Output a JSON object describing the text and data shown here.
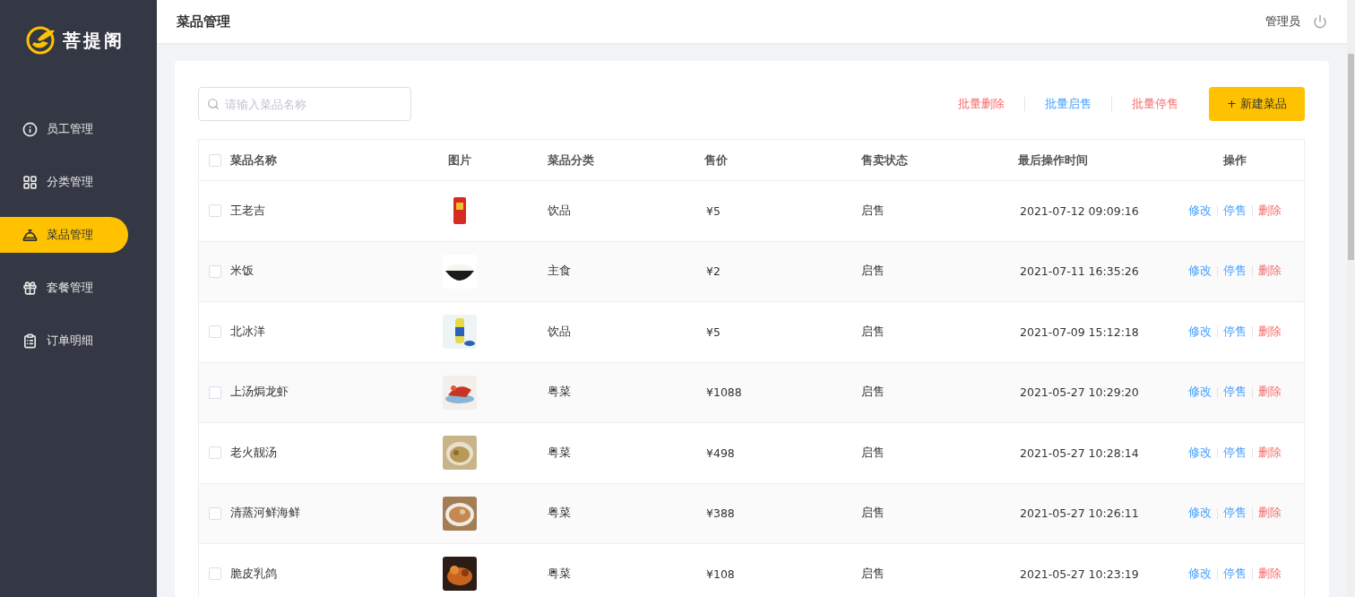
{
  "brand": {
    "name": "菩提阁"
  },
  "sidebar": {
    "items": [
      {
        "label": "员工管理",
        "selected": false
      },
      {
        "label": "分类管理",
        "selected": false
      },
      {
        "label": "菜品管理",
        "selected": true
      },
      {
        "label": "套餐管理",
        "selected": false
      },
      {
        "label": "订单明细",
        "selected": false
      }
    ]
  },
  "header": {
    "title": "菜品管理",
    "user": "管理员"
  },
  "toolbar": {
    "search": {
      "placeholder": "请输入菜品名称"
    },
    "actions": [
      {
        "label": "批量删除",
        "kind": "danger"
      },
      {
        "label": "批量启售",
        "kind": "primary"
      },
      {
        "label": "批量停售",
        "kind": "danger"
      }
    ],
    "create_button": "+ 新建菜品"
  },
  "table": {
    "select_all": {
      "checked": false
    },
    "columns": [
      "菜品名称",
      "图片",
      "菜品分类",
      "售价",
      "售卖状态",
      "最后操作时间",
      "操作"
    ],
    "rows": [
      {
        "checked": false,
        "name": "王老吉",
        "category": "饮品",
        "price": "¥5",
        "status": "启售",
        "updated": "2021-07-12 09:09:16",
        "actions": [
          {
            "label": "修改",
            "kind": "primary"
          },
          {
            "label": "停售",
            "kind": "primary"
          },
          {
            "label": "删除",
            "kind": "danger"
          }
        ]
      },
      {
        "checked": false,
        "name": "米饭",
        "category": "主食",
        "price": "¥2",
        "status": "启售",
        "updated": "2021-07-11 16:35:26",
        "actions": [
          {
            "label": "修改",
            "kind": "primary"
          },
          {
            "label": "停售",
            "kind": "primary"
          },
          {
            "label": "删除",
            "kind": "danger"
          }
        ]
      },
      {
        "checked": false,
        "name": "北冰洋",
        "category": "饮品",
        "price": "¥5",
        "status": "启售",
        "updated": "2021-07-09 15:12:18",
        "actions": [
          {
            "label": "修改",
            "kind": "primary"
          },
          {
            "label": "停售",
            "kind": "primary"
          },
          {
            "label": "删除",
            "kind": "danger"
          }
        ]
      },
      {
        "checked": false,
        "name": "上汤焗龙虾",
        "category": "粤菜",
        "price": "¥1088",
        "status": "启售",
        "updated": "2021-05-27 10:29:20",
        "actions": [
          {
            "label": "修改",
            "kind": "primary"
          },
          {
            "label": "停售",
            "kind": "primary"
          },
          {
            "label": "删除",
            "kind": "danger"
          }
        ]
      },
      {
        "checked": false,
        "name": "老火靓汤",
        "category": "粤菜",
        "price": "¥498",
        "status": "启售",
        "updated": "2021-05-27 10:28:14",
        "actions": [
          {
            "label": "修改",
            "kind": "primary"
          },
          {
            "label": "停售",
            "kind": "primary"
          },
          {
            "label": "删除",
            "kind": "danger"
          }
        ]
      },
      {
        "checked": false,
        "name": "清蒸河鲜海鲜",
        "category": "粤菜",
        "price": "¥388",
        "status": "启售",
        "updated": "2021-05-27 10:26:11",
        "actions": [
          {
            "label": "修改",
            "kind": "primary"
          },
          {
            "label": "停售",
            "kind": "primary"
          },
          {
            "label": "删除",
            "kind": "danger"
          }
        ]
      },
      {
        "checked": false,
        "name": "脆皮乳鸽",
        "category": "粤菜",
        "price": "¥108",
        "status": "启售",
        "updated": "2021-05-27 10:23:19",
        "actions": [
          {
            "label": "修改",
            "kind": "primary"
          },
          {
            "label": "停售",
            "kind": "primary"
          },
          {
            "label": "删除",
            "kind": "danger"
          }
        ]
      }
    ]
  }
}
